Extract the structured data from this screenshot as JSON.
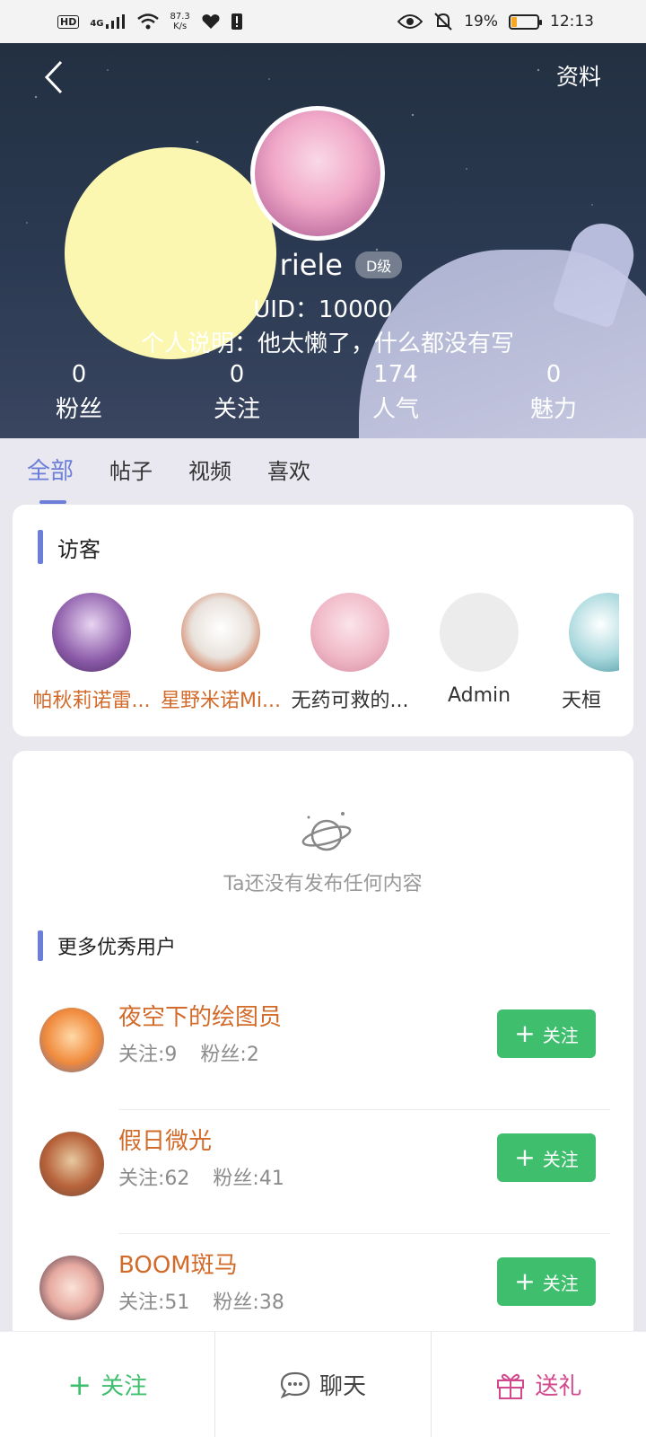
{
  "status_bar": {
    "network": "HD",
    "signal": "4G",
    "speed_value": "87.3",
    "speed_unit": "K/s",
    "battery": "19%",
    "time": "12:13"
  },
  "header": {
    "profile_label": "资料",
    "username": "riele",
    "level": "D级",
    "uid": "UID：10000",
    "bio": "个人说明：他太懒了，什么都没有写",
    "stats": [
      {
        "value": "0",
        "label": "粉丝"
      },
      {
        "value": "0",
        "label": "关注"
      },
      {
        "value": "174",
        "label": "人气"
      },
      {
        "value": "0",
        "label": "魅力"
      }
    ]
  },
  "tabs": [
    "全部",
    "帖子",
    "视频",
    "喜欢"
  ],
  "visitors": {
    "title": "访客",
    "items": [
      {
        "name": "帕秋莉诺雷...",
        "color": "#d26a2a"
      },
      {
        "name": "星野米诺Mi...",
        "color": "#d26a2a"
      },
      {
        "name": "无药可救的...",
        "color": "#333333"
      },
      {
        "name": "Admin",
        "color": "#333333"
      },
      {
        "name": "天桓",
        "color": "#333333"
      }
    ]
  },
  "content": {
    "empty_text": "Ta还没有发布任何内容",
    "more_users_title": "更多优秀用户",
    "users": [
      {
        "name": "夜空下的绘图员",
        "following": "关注:9",
        "fans": "粉丝:2",
        "follow_label": "关注"
      },
      {
        "name": "假日微光",
        "following": "关注:62",
        "fans": "粉丝:41",
        "follow_label": "关注"
      },
      {
        "name": "BOOM斑马",
        "following": "关注:51",
        "fans": "粉丝:38",
        "follow_label": "关注"
      }
    ]
  },
  "bottom_bar": {
    "follow": "关注",
    "chat": "聊天",
    "gift": "送礼"
  },
  "colors": {
    "accent": "#6c7fd8",
    "follow_green": "#3fbf6e",
    "name_orange": "#d26a2a",
    "gift_pink": "#d2488c"
  }
}
